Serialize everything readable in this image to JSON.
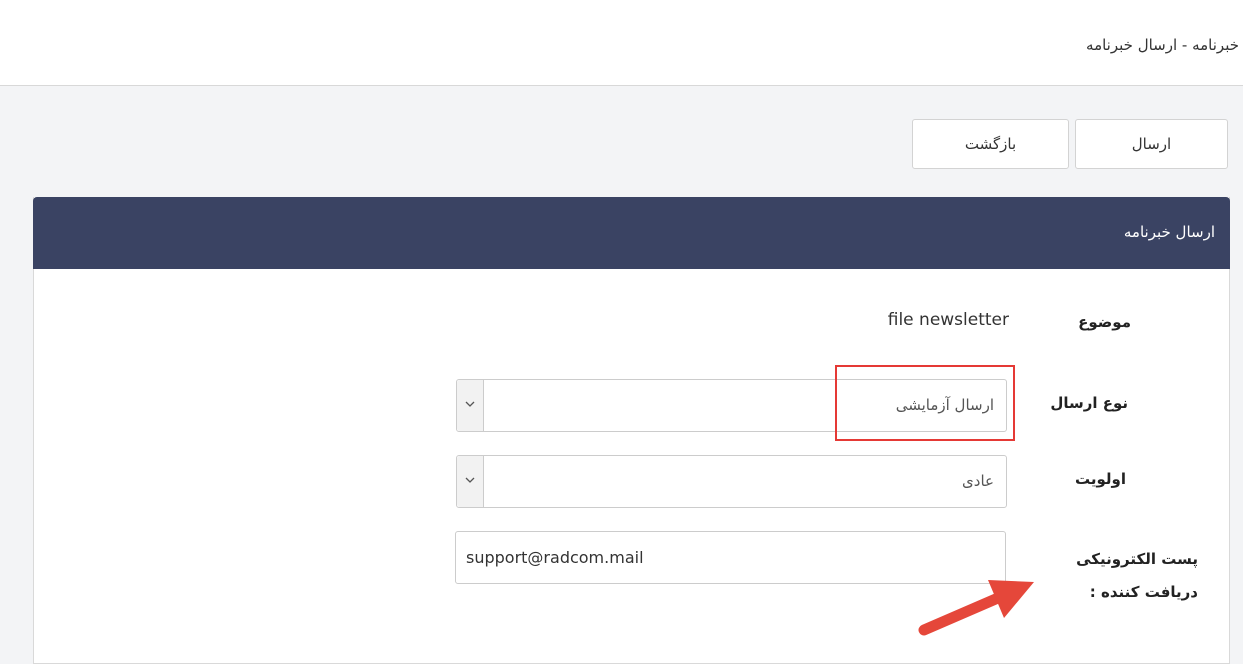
{
  "header": {
    "breadcrumb": "خبرنامه - ارسال خبرنامه"
  },
  "toolbar": {
    "send_label": "ارسال",
    "back_label": "بازگشت"
  },
  "panel": {
    "title": "ارسال خبرنامه"
  },
  "form": {
    "subject": {
      "label": "موضوع",
      "value": "file newsletter"
    },
    "send_type": {
      "label": "نوع ارسال",
      "selected": "ارسال آزمایشی"
    },
    "priority": {
      "label": "اولویت",
      "selected": "عادی"
    },
    "recipient_email": {
      "label_line1": "پست الکترونیکی",
      "label_line2": "دریافت کننده :",
      "value": "support@radcom.mail"
    }
  },
  "icons": {
    "select_arrow": "chevron-down-icon",
    "annotation": "arrow-icon"
  },
  "colors": {
    "panel_header": "#3a4363",
    "highlight": "#e53935",
    "annotation_arrow": "#e5473a"
  }
}
